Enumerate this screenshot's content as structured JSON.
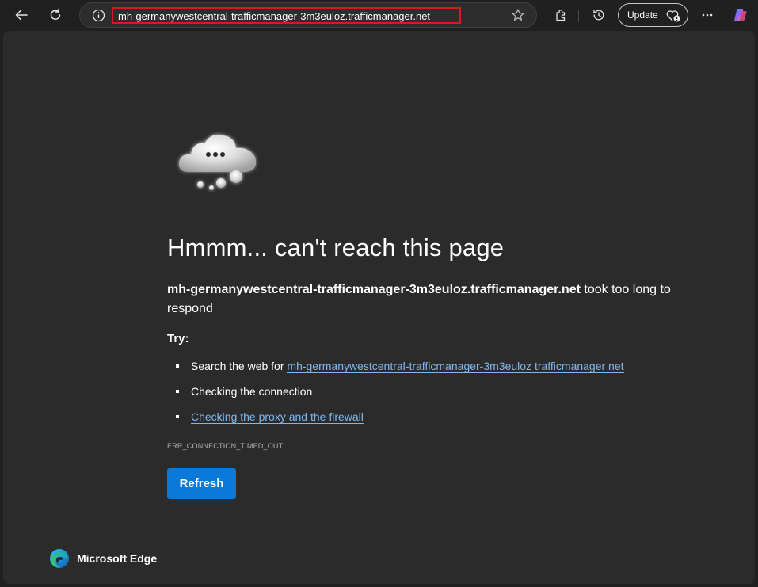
{
  "toolbar": {
    "back_icon": "back-arrow-icon",
    "refresh_icon": "refresh-icon",
    "url": "mh-germanywestcentral-trafficmanager-3m3euloz.trafficmanager.net",
    "update_label": "Update",
    "more_icon": "more-icon"
  },
  "error_page": {
    "heading": "Hmmm... can't reach this page",
    "host": "mh-germanywestcentral-trafficmanager-3m3euloz.trafficmanager.net",
    "message_suffix": " took too long to respond",
    "try_label": "Try:",
    "suggestions": [
      {
        "prefix": "Search the web for ",
        "link": "mh-germanywestcentral-trafficmanager-3m3euloz trafficmanager net"
      },
      {
        "prefix": "Checking the connection",
        "link": ""
      },
      {
        "prefix": "",
        "link": "Checking the proxy and the firewall"
      }
    ],
    "error_code": "ERR_CONNECTION_TIMED_OUT",
    "refresh_label": "Refresh"
  },
  "brand": {
    "name": "Microsoft Edge"
  },
  "colors": {
    "accent": "#0b79d8",
    "link": "#7fb8ee",
    "url_highlight": "#e0161e"
  }
}
